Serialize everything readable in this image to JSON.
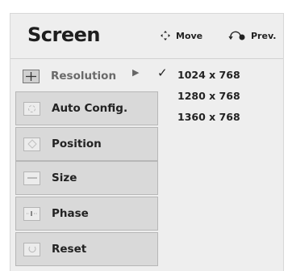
{
  "header": {
    "title": "Screen",
    "hints": [
      {
        "icon": "move-icon",
        "label": "Move"
      },
      {
        "icon": "prev-icon",
        "label": "Prev."
      }
    ]
  },
  "menu": {
    "items": [
      {
        "label": "Resolution",
        "icon": "resolution-icon",
        "state": "active"
      },
      {
        "label": "Auto Config.",
        "icon": "auto-config-icon",
        "state": "inactive"
      },
      {
        "label": "Position",
        "icon": "position-icon",
        "state": "inactive"
      },
      {
        "label": "Size",
        "icon": "size-icon",
        "state": "inactive"
      },
      {
        "label": "Phase",
        "icon": "phase-icon",
        "state": "inactive"
      },
      {
        "label": "Reset",
        "icon": "reset-icon",
        "state": "inactive"
      }
    ]
  },
  "submenu": {
    "options": [
      "1024 x 768",
      "1280 x 768",
      "1360 x 768"
    ],
    "selected": "1024 x 768"
  }
}
